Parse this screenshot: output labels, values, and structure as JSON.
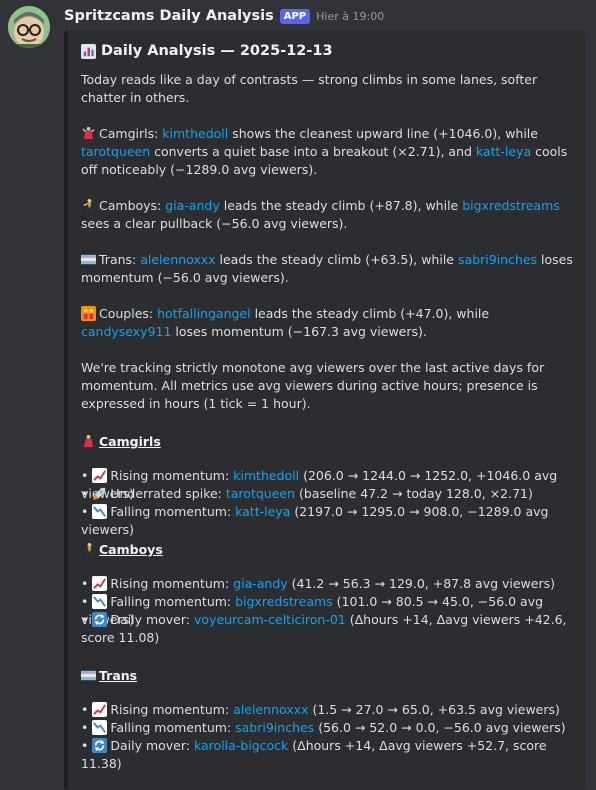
{
  "message": {
    "author": "Spritzcams Daily Analysis",
    "badge": "APP",
    "timestamp": "Hier à 19:00"
  },
  "embed": {
    "title": "Daily Analysis — 2025-12-13",
    "intro": "Today reads like a day of contrasts — strong climbs in some lanes, softer chatter in others.",
    "summaries": {
      "camgirls": {
        "lane": "Camgirls:",
        "u1": "kimthedoll",
        "t1": " shows the cleanest upward line (+1046.0), while ",
        "u2": "tarotqueen",
        "t2": " converts a quiet base into a breakout (×2.71), and ",
        "u3": "katt-leya",
        "t3": " cools off noticeably (−1289.0 avg viewers)."
      },
      "camboys": {
        "lane": "Camboys:",
        "u1": "gia-andy",
        "t1": " leads the steady climb (+87.8), while ",
        "u2": "bigxredstreams",
        "t2": " sees a clear pullback (−56.0 avg viewers)."
      },
      "trans": {
        "lane": "Trans:",
        "u1": "alelennoxxx",
        "t1": " leads the steady climb (+63.5), while ",
        "u2": "sabri9inches",
        "t2": " loses momentum (−56.0 avg viewers)."
      },
      "couples": {
        "lane": "Couples:",
        "u1": "hotfallingangel",
        "t1": " leads the steady climb (+47.0), while ",
        "u2": "candysexy911",
        "t2": " loses momentum (−167.3 avg viewers)."
      }
    },
    "methodology": "We're tracking strictly monotone avg viewers over the last active days for momentum. All metrics use avg viewers during active hours; presence is expressed in hours (1 tick = 1 hour).",
    "sections": {
      "camgirls": {
        "title": "Camgirls",
        "rising": {
          "label": "Rising momentum:",
          "user": "kimthedoll",
          "detail": "(206.0 → 1244.0 → 1252.0, +1046.0 avg viewers)"
        },
        "spike": {
          "label": "Underrated spike:",
          "user": "tarotqueen",
          "detail": "(baseline 47.2 → today 128.0, ×2.71)"
        },
        "falling": {
          "label": "Falling momentum:",
          "user": "katt-leya",
          "detail": "(2197.0 → 1295.0 → 908.0, −1289.0 avg viewers)"
        }
      },
      "camboys": {
        "title": "Camboys",
        "rising": {
          "label": "Rising momentum:",
          "user": "gia-andy",
          "detail": "(41.2 → 56.3 → 129.0, +87.8 avg viewers)"
        },
        "falling": {
          "label": "Falling momentum:",
          "user": "bigxredstreams",
          "detail": "(101.0 → 80.5 → 45.0, −56.0 avg viewers)"
        },
        "mover": {
          "label": "Daily mover:",
          "user": "voyeurcam-celticiron-01",
          "detail": "(Δhours +14, Δavg viewers +42.6, score 11.08)"
        }
      },
      "trans": {
        "title": "Trans",
        "rising": {
          "label": "Rising momentum:",
          "user": "alelennoxxx",
          "detail": "(1.5 → 27.0 → 65.0, +63.5 avg viewers)"
        },
        "falling": {
          "label": "Falling momentum:",
          "user": "sabri9inches",
          "detail": "(56.0 → 52.0 → 0.0, −56.0 avg viewers)"
        },
        "mover": {
          "label": "Daily mover:",
          "user": "karolla-bigcock",
          "detail": "(Δhours +14, Δavg viewers +52.7, score 11.38)"
        }
      }
    }
  },
  "icons": {
    "chart": "bar-chart-icon",
    "camgirls": "dancer-icon",
    "camboys": "man-dancing-icon",
    "trans": "trans-flag-icon",
    "couples": "couple-icon",
    "rising": "chart-increasing-icon",
    "falling": "chart-decreasing-icon",
    "spike": "rocket-icon",
    "mover": "arrows-cycle-icon"
  },
  "colors": {
    "background": "#313338",
    "embed": "#2b2d31",
    "mention": "#00a8fc",
    "badge": "#5865f2"
  }
}
